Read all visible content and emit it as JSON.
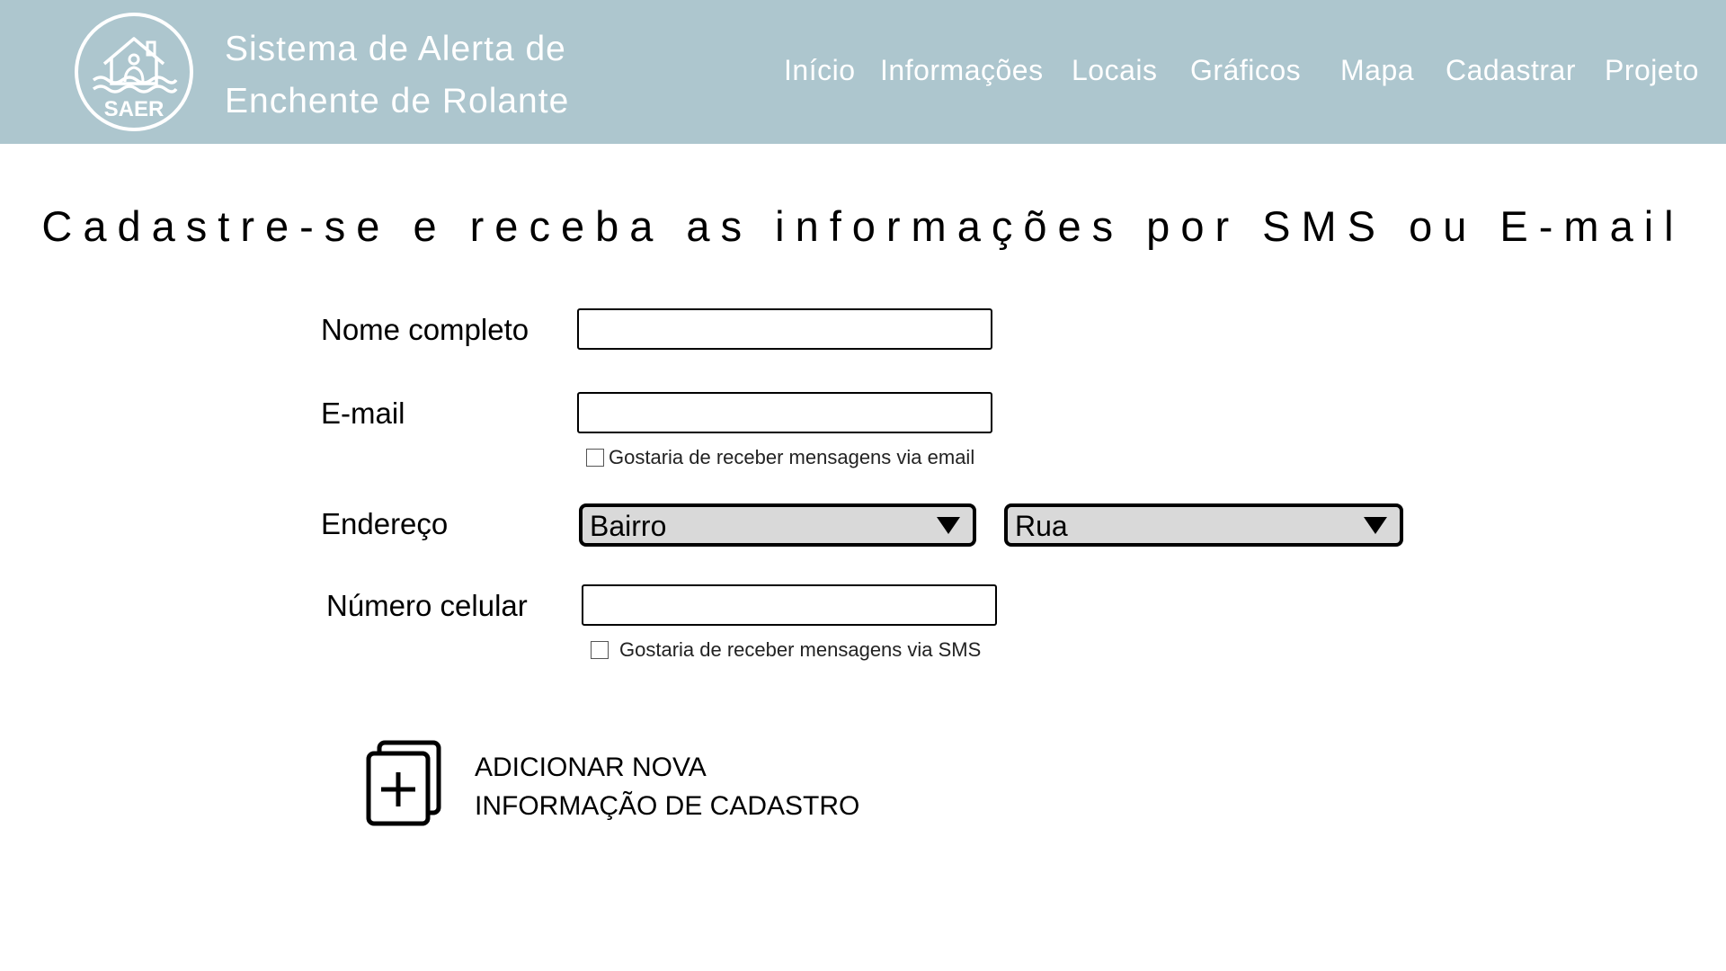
{
  "header": {
    "logo_text": "SAER",
    "title_line1": "Sistema de Alerta de",
    "title_line2": "Enchente de Rolante",
    "nav": [
      "Início",
      "Informações",
      "Locais",
      "Gráficos",
      "Mapa",
      "Cadastrar",
      "Projeto"
    ],
    "background_color": "#adc6ce"
  },
  "main": {
    "heading": "Cadastre-se e receba as informações por SMS ou E-mail",
    "form": {
      "name_label": "Nome completo",
      "name_value": "",
      "email_label": "E-mail",
      "email_value": "",
      "email_checkbox_label": "Gostaria de receber mensagens via email",
      "email_checkbox_checked": false,
      "address_label": "Endereço",
      "neighborhood_select": "Bairro",
      "street_select": "Rua",
      "phone_label": "Número celular",
      "phone_value": "",
      "sms_checkbox_label": "Gostaria de receber mensagens via SMS",
      "sms_checkbox_checked": false
    },
    "add_entry": {
      "line1": "ADICIONAR NOVA",
      "line2": "INFORMAÇÃO DE CADASTRO",
      "icon": "add-copy-icon"
    }
  }
}
